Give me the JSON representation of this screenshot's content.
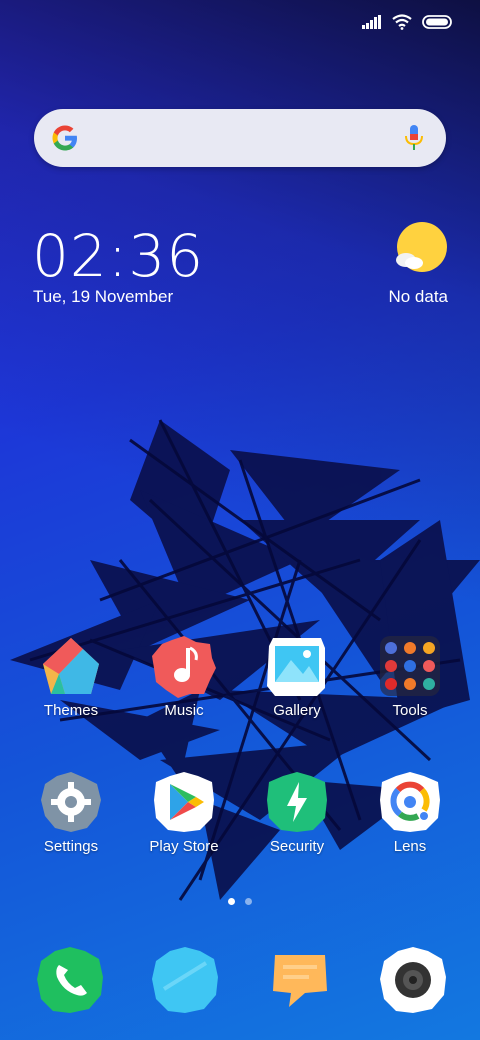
{
  "status_bar": {
    "icons": [
      "signal-icon",
      "wifi-icon",
      "battery-icon"
    ]
  },
  "search": {
    "logo": "google-logo-icon",
    "mic": "mic-icon"
  },
  "clock": {
    "time": "02:36",
    "date": "Tue, 19 November"
  },
  "weather": {
    "icon": "sun-cloud-icon",
    "text": "No data"
  },
  "apps_row1": [
    {
      "label": "Themes",
      "icon": "themes-icon"
    },
    {
      "label": "Music",
      "icon": "music-icon"
    },
    {
      "label": "Gallery",
      "icon": "gallery-icon"
    },
    {
      "label": "Tools",
      "icon": "tools-folder-icon"
    }
  ],
  "apps_row2": [
    {
      "label": "Settings",
      "icon": "settings-icon"
    },
    {
      "label": "Play Store",
      "icon": "play-store-icon"
    },
    {
      "label": "Security",
      "icon": "security-icon"
    },
    {
      "label": "Lens",
      "icon": "lens-icon"
    }
  ],
  "page_indicator": {
    "pages": 2,
    "current": 1
  },
  "dock": [
    {
      "icon": "phone-icon"
    },
    {
      "icon": "messages-icon"
    },
    {
      "icon": "chat-icon"
    },
    {
      "icon": "camera-icon"
    }
  ],
  "colors": {
    "accent_red": "#f05a5a",
    "accent_green": "#1fbf5f",
    "accent_cyan": "#3fc6f3",
    "accent_orange": "#ffb85a"
  }
}
